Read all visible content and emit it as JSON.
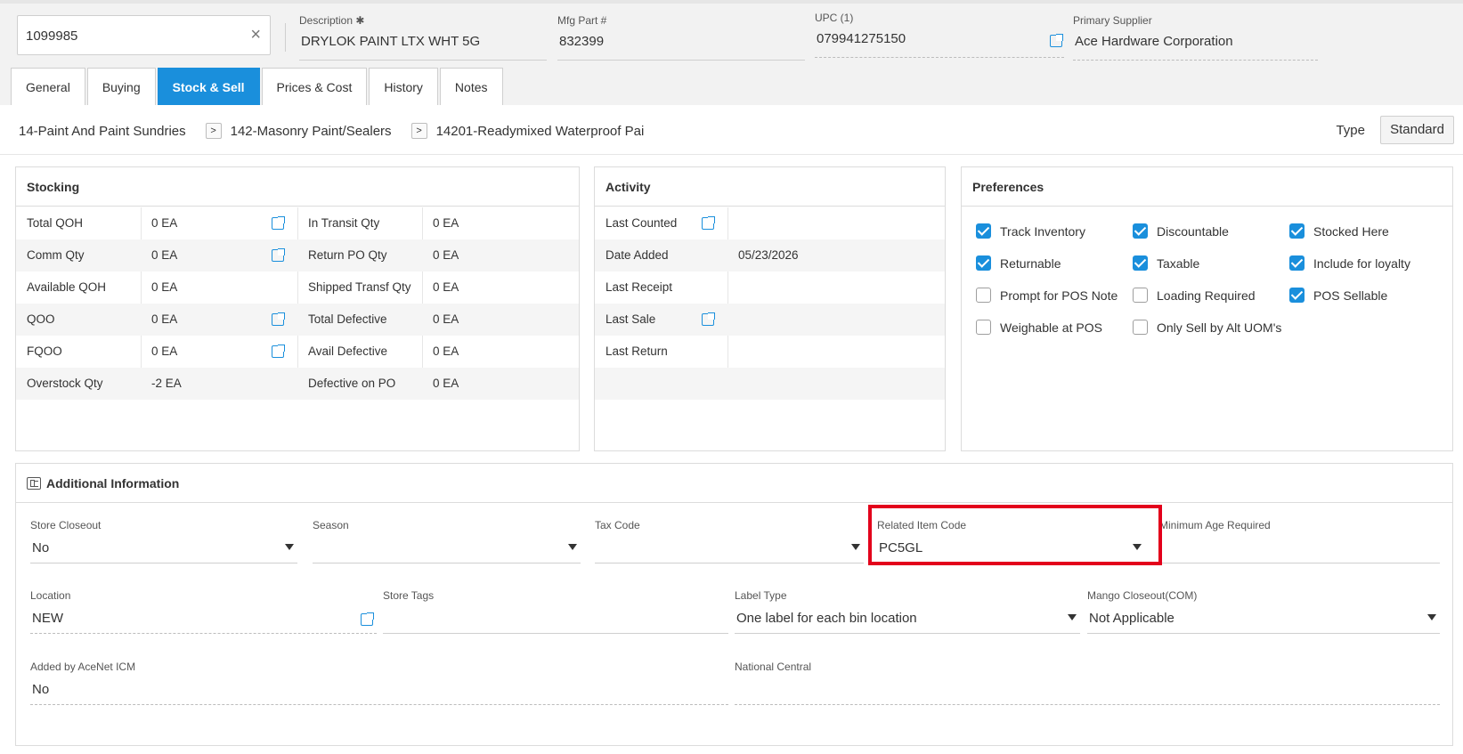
{
  "header": {
    "item_search_value": "1099985",
    "clear_symbol": "×",
    "description_label": "Description",
    "description_required": "✱",
    "description_value": "DRYLOK PAINT LTX WHT 5G",
    "mfg_label": "Mfg Part #",
    "mfg_value": "832399",
    "upc_label": "UPC (1)",
    "upc_value": "079941275150",
    "supplier_label": "Primary Supplier",
    "supplier_value": "Ace Hardware Corporation"
  },
  "tabs": [
    {
      "label": "General"
    },
    {
      "label": "Buying"
    },
    {
      "label": "Stock & Sell",
      "active": true
    },
    {
      "label": "Prices & Cost"
    },
    {
      "label": "History"
    },
    {
      "label": "Notes"
    }
  ],
  "breadcrumb": {
    "items": [
      "14-Paint And Paint Sundries",
      "142-Masonry Paint/Sealers",
      "14201-Readymixed Waterproof Pai"
    ],
    "separator": ">"
  },
  "type": {
    "label": "Type",
    "value": "Standard"
  },
  "stocking": {
    "title": "Stocking",
    "rows": [
      {
        "l1": "Total QOH",
        "v1": "0 EA",
        "l2": "In Transit Qty",
        "v2": "0 EA"
      },
      {
        "l1": "Comm Qty",
        "v1": "0 EA",
        "l2": "Return PO Qty",
        "v2": "0 EA"
      },
      {
        "l1": "Available QOH",
        "v1": "0 EA",
        "l2": "Shipped Transf Qty",
        "v2": "0 EA"
      },
      {
        "l1": "QOO",
        "v1": "0 EA",
        "l2": "Total Defective",
        "v2": "0 EA"
      },
      {
        "l1": "FQOO",
        "v1": "0 EA",
        "l2": "Avail Defective",
        "v2": "0 EA"
      },
      {
        "l1": "Overstock Qty",
        "v1": "-2 EA",
        "l2": "Defective on PO",
        "v2": "0 EA"
      }
    ]
  },
  "activity": {
    "title": "Activity",
    "rows": [
      {
        "label": "Last Counted",
        "value": ""
      },
      {
        "label": "Date Added",
        "value": "05/23/2026"
      },
      {
        "label": "Last Receipt",
        "value": ""
      },
      {
        "label": "Last Sale",
        "value": ""
      },
      {
        "label": "Last Return",
        "value": ""
      },
      {
        "label": "",
        "value": ""
      }
    ]
  },
  "preferences": {
    "title": "Preferences",
    "items": [
      {
        "label": "Track Inventory",
        "checked": true
      },
      {
        "label": "Discountable",
        "checked": true
      },
      {
        "label": "Stocked Here",
        "checked": true
      },
      {
        "label": "Returnable",
        "checked": true
      },
      {
        "label": "Taxable",
        "checked": true
      },
      {
        "label": "Include for loyalty",
        "checked": true
      },
      {
        "label": "Prompt for POS Note",
        "checked": false
      },
      {
        "label": "Loading Required",
        "checked": false
      },
      {
        "label": "POS Sellable",
        "checked": true
      },
      {
        "label": "Weighable at POS",
        "checked": false
      },
      {
        "label": "Only Sell by Alt UOM's",
        "checked": false
      }
    ]
  },
  "additional": {
    "title": "Additional Information",
    "store_closeout": {
      "label": "Store Closeout",
      "value": "No"
    },
    "season": {
      "label": "Season",
      "value": ""
    },
    "tax_code": {
      "label": "Tax Code",
      "value": ""
    },
    "related_item": {
      "label": "Related Item Code",
      "value": "PC5GL"
    },
    "min_age": {
      "label": "Minimum Age Required",
      "value": ""
    },
    "location": {
      "label": "Location",
      "value": "NEW"
    },
    "store_tags": {
      "label": "Store Tags",
      "value": ""
    },
    "label_type": {
      "label": "Label Type",
      "value": "One label for each bin location"
    },
    "mango": {
      "label": "Mango Closeout(COM)",
      "value": "Not Applicable"
    },
    "added_by": {
      "label": "Added by AceNet ICM",
      "value": "No"
    },
    "national_central": {
      "label": "National Central",
      "value": ""
    }
  },
  "colors": {
    "accent": "#1a8fdc",
    "highlight": "#e3001b"
  }
}
